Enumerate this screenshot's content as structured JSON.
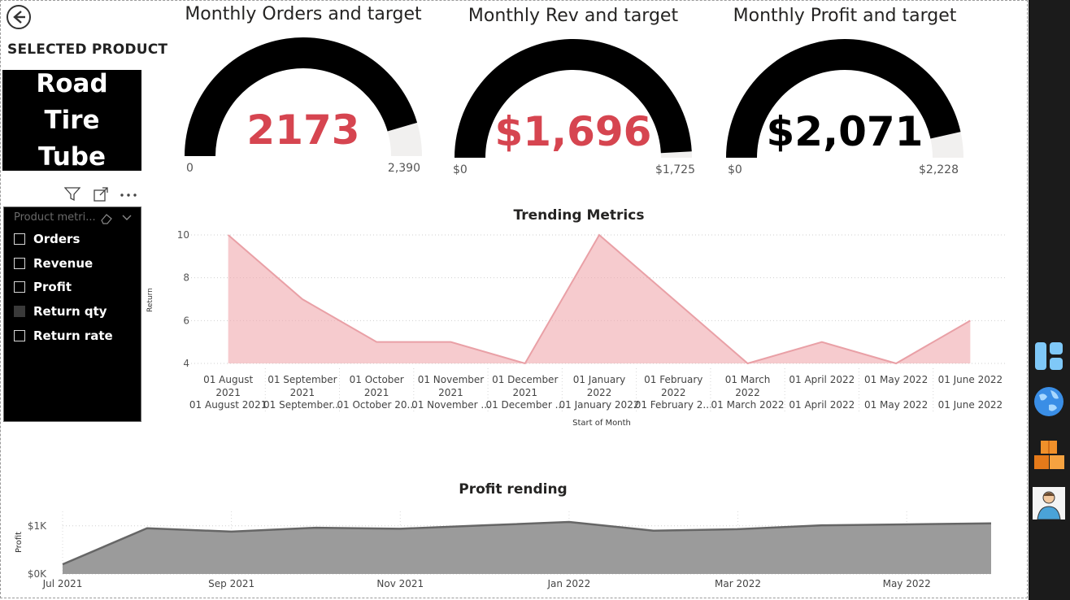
{
  "header": {
    "back_label": "Back",
    "selected_label": "SELECTED PRODUCT",
    "product_name": "Road Tire Tube"
  },
  "slicer": {
    "header": "Product metri...",
    "items": [
      {
        "label": "Orders",
        "checked": false
      },
      {
        "label": "Revenue",
        "checked": false
      },
      {
        "label": "Profit",
        "checked": false
      },
      {
        "label": "Return qty",
        "checked": true
      },
      {
        "label": "Return rate",
        "checked": false
      }
    ],
    "tool_icons": [
      "filter-icon",
      "focus-mode-icon",
      "more-options-icon"
    ],
    "header_icons": [
      "eraser-icon",
      "chevron-down-icon"
    ]
  },
  "gauges": [
    {
      "title": "Monthly Orders and target",
      "value": "2173",
      "min_label": "0",
      "max_label": "2,390",
      "value_color": "#d64550",
      "fraction": 0.909
    },
    {
      "title": "Monthly Rev and target",
      "value": "$1,696",
      "min_label": "$0",
      "max_label": "$1,725",
      "value_color": "#d64550",
      "fraction": 0.983
    },
    {
      "title": "Monthly Profit and target",
      "value": "$2,071",
      "min_label": "$0",
      "max_label": "$2,228",
      "value_color": "#000000",
      "fraction": 0.93
    }
  ],
  "chart_data": [
    {
      "type": "area",
      "title": "Trending Metrics",
      "xlabel": "Start of Month",
      "ylabel": "Return",
      "ylim": [
        4,
        10
      ],
      "yticks": [
        "10",
        "8",
        "6",
        "4"
      ],
      "categories": [
        [
          "01 August",
          "2021",
          "01 August 2021"
        ],
        [
          "01 September",
          "2021",
          "01 September..."
        ],
        [
          "01 October",
          "2021",
          "01 October 20..."
        ],
        [
          "01 November",
          "2021",
          "01 November ..."
        ],
        [
          "01 December",
          "2021",
          "01 December ..."
        ],
        [
          "01 January",
          "2022",
          "01 January 2022"
        ],
        [
          "01 February",
          "2022",
          "01 February 2..."
        ],
        [
          "01 March",
          "2022",
          "01 March 2022"
        ],
        [
          "01 April 2022",
          "",
          "01 April 2022"
        ],
        [
          "01 May 2022",
          "",
          "01 May 2022"
        ],
        [
          "01 June 2022",
          "",
          "01 June 2022"
        ]
      ],
      "series": [
        {
          "values": [
            10,
            7,
            5,
            5,
            4,
            10,
            7,
            4,
            5,
            4,
            6
          ]
        }
      ],
      "color": "#f0a8ad",
      "grid": true
    },
    {
      "type": "area",
      "title": "Profit rending",
      "xlabel": "",
      "ylabel": "Profit",
      "yticks": [
        "$1K",
        "$0K"
      ],
      "xticks": [
        "Jul 2021",
        "Sep 2021",
        "Nov 2021",
        "Jan 2022",
        "Mar 2022",
        "May 2022"
      ],
      "x": [
        "Jul 2021",
        "Aug 2021",
        "Sep 2021",
        "Oct 2021",
        "Nov 2021",
        "Dec 2021",
        "Jan 2022",
        "Feb 2022",
        "Mar 2022",
        "Apr 2022",
        "May 2022",
        "Jun 2022"
      ],
      "series": [
        {
          "values": [
            200,
            950,
            880,
            960,
            940,
            1010,
            1080,
            900,
            930,
            1010,
            1030,
            1050
          ]
        }
      ],
      "ylim": [
        0,
        1300
      ],
      "color": "#9b9b9b",
      "grid": true
    }
  ],
  "rail": {
    "icons": [
      "dashboard-icon",
      "globe-icon",
      "boxes-icon",
      "person-avatar-icon"
    ]
  }
}
